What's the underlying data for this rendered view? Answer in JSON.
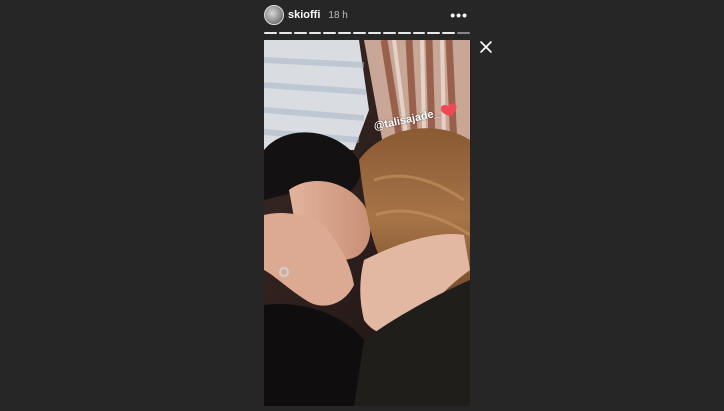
{
  "story": {
    "username": "skioffi",
    "timestamp": "18 h",
    "segments": 14,
    "current_segment": 14,
    "mention": "@talisajade_"
  },
  "colors": {
    "background": "#262626",
    "heart": "#ed4956"
  },
  "icons": {
    "avatar": "user-avatar",
    "more": "more-options-icon",
    "close": "close-icon",
    "heart": "heart-icon"
  }
}
